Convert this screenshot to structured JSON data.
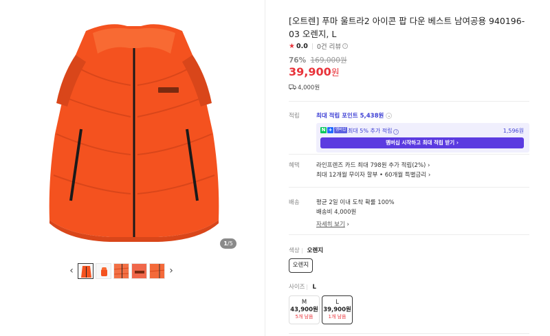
{
  "gallery": {
    "page_current": "1",
    "page_total": "/5",
    "prev_icon": "chevron-left-icon",
    "next_icon": "chevron-right-icon",
    "prev_glyph": "‹",
    "next_glyph": "›"
  },
  "product": {
    "title": "[오트렌] 푸마 울트라2 아이콘 팝 다운 베스트 남여공용 940196-03 오렌지, L",
    "rating_score": "0.0",
    "review_count": "0건 리뷰",
    "discount_rate": "76%",
    "original_price": "169,000원",
    "sale_price": "39,900",
    "sale_unit": "원",
    "shipping_fee": "4,000원",
    "brand_color": "#e8333a",
    "accent_color": "#5b3be0"
  },
  "points": {
    "label": "적립",
    "max_points_text": "최대 적립 포인트 5,438원",
    "membership_text": "최대 5% 추가 적립",
    "membership_amount": "1,596원",
    "membership_badge": "멤버십",
    "membership_button": "멤버십 시작하고 최대 적립 받기 ›"
  },
  "benefits": {
    "label": "혜택",
    "line1": "라인프렌즈 카드 최대 798원 추가 적립(2%) ›",
    "line2": "최대 12개월 무이자 할부 • 60개월 특별금리 ›"
  },
  "delivery": {
    "label": "배송",
    "line1": "평균 2일 이내 도착 확률 100%",
    "line2": "배송비 4,000원",
    "detail_link": "자세히 보기",
    "detail_chevron": "›"
  },
  "options": {
    "color_label": "색상",
    "color_value": "오렌지",
    "color_chip": "오렌지",
    "size_label": "사이즈",
    "size_value": "L",
    "sizes": [
      {
        "size": "M",
        "price": "43,900원",
        "stock": "5개 남음"
      },
      {
        "size": "L",
        "price": "39,900원",
        "stock": "1개 남음"
      }
    ]
  }
}
